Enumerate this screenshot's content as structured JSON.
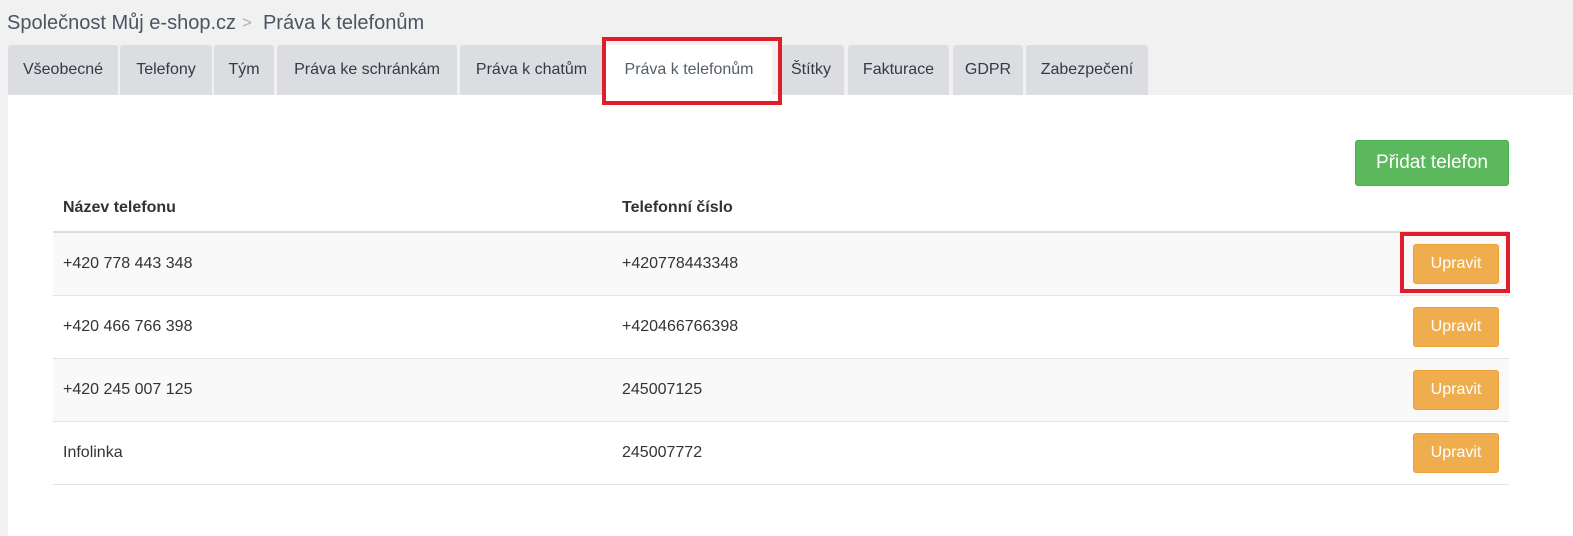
{
  "breadcrumb": {
    "company": "Společnost Můj e-shop.cz",
    "separator": ">",
    "current": "Práva k telefonům"
  },
  "tabs": [
    {
      "label": "Všeobecné",
      "active": false
    },
    {
      "label": "Telefony",
      "active": false
    },
    {
      "label": "Tým",
      "active": false
    },
    {
      "label": "Práva ke schránkám",
      "active": false
    },
    {
      "label": "Práva k chatům",
      "active": false
    },
    {
      "label": "Práva k telefonům",
      "active": true
    },
    {
      "label": "Štítky",
      "active": false
    },
    {
      "label": "Fakturace",
      "active": false
    },
    {
      "label": "GDPR",
      "active": false
    },
    {
      "label": "Zabezpečení",
      "active": false
    }
  ],
  "toolbar": {
    "add_label": "Přidat telefon"
  },
  "table": {
    "headers": {
      "name": "Název telefonu",
      "number": "Telefonní číslo"
    },
    "rows": [
      {
        "name": "+420 778 443 348",
        "number": "+420778443348",
        "action": "Upravit"
      },
      {
        "name": "+420 466 766 398",
        "number": "+420466766398",
        "action": "Upravit"
      },
      {
        "name": "+420 245 007 125",
        "number": "245007125",
        "action": "Upravit"
      },
      {
        "name": "Infolinka",
        "number": "245007772",
        "action": "Upravit"
      }
    ]
  },
  "colors": {
    "accent_green": "#5cb85c",
    "accent_orange": "#f0ad4e",
    "highlight_red": "#e01e2b",
    "tab_bg": "#dcdde0",
    "page_bg": "#f1f1f2"
  }
}
